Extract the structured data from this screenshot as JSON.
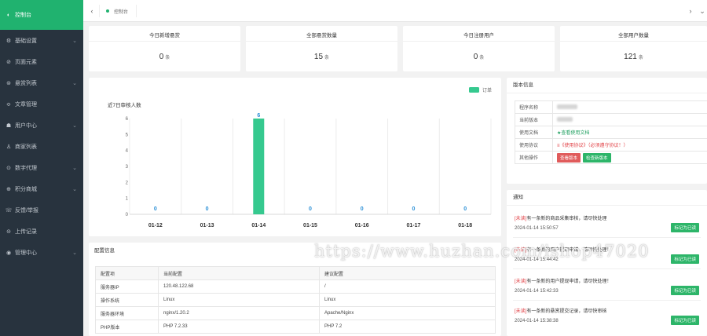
{
  "sidebar": {
    "items": [
      {
        "label": "控制台",
        "icon": "dashboard-icon",
        "glyph": "◐",
        "chevron": false,
        "active": true
      },
      {
        "label": "基础设置",
        "icon": "settings-icon",
        "glyph": "⚙",
        "chevron": true
      },
      {
        "label": "页面元素",
        "icon": "page-icon",
        "glyph": "⊘",
        "chevron": false
      },
      {
        "label": "悬赏列表",
        "icon": "reward-icon",
        "glyph": "⊜",
        "chevron": true
      },
      {
        "label": "文章管理",
        "icon": "article-icon",
        "glyph": "≎",
        "chevron": false
      },
      {
        "label": "用户中心",
        "icon": "user-icon",
        "glyph": "☗",
        "chevron": true
      },
      {
        "label": "商家列表",
        "icon": "shop-icon",
        "glyph": "♙",
        "chevron": false
      },
      {
        "label": "数字代理",
        "icon": "agent-icon",
        "glyph": "⊙",
        "chevron": true
      },
      {
        "label": "积分商城",
        "icon": "mall-icon",
        "glyph": "⊕",
        "chevron": true
      },
      {
        "label": "反馈/举报",
        "icon": "feedback-icon",
        "glyph": "☏",
        "chevron": false
      },
      {
        "label": "上传记录",
        "icon": "upload-icon",
        "glyph": "⊝",
        "chevron": false
      },
      {
        "label": "管理中心",
        "icon": "admin-icon",
        "glyph": "◉",
        "chevron": true
      }
    ]
  },
  "topbar": {
    "prev_glyph": "‹",
    "next_glyph": "›",
    "menu_glyph": "⌄",
    "tab_label": "控制台"
  },
  "stats": [
    {
      "title": "今日新增悬赏",
      "value": "0",
      "unit": "条"
    },
    {
      "title": "全部悬赏数量",
      "value": "15",
      "unit": "条"
    },
    {
      "title": "今日注册用户",
      "value": "0",
      "unit": "条"
    },
    {
      "title": "全部用户数量",
      "value": "121",
      "unit": "条"
    }
  ],
  "chart_data": {
    "type": "bar",
    "title": "近7日审核人数",
    "legend": "订单",
    "legend_position": "top-right",
    "categories": [
      "01-12",
      "01-13",
      "01-14",
      "01-15",
      "01-16",
      "01-17",
      "01-18"
    ],
    "values": [
      0,
      0,
      6,
      0,
      0,
      0,
      0
    ],
    "ylim": [
      0,
      6
    ],
    "yticks": [
      0,
      1,
      2,
      3,
      4,
      5,
      6
    ],
    "grid": true,
    "bar_color": "#36c98f"
  },
  "version_info": {
    "title": "版本信息",
    "rows": [
      {
        "key": "程序名称",
        "value": ""
      },
      {
        "key": "当前版本",
        "value": ""
      },
      {
        "key": "使用文档",
        "value": "★查看使用文档"
      },
      {
        "key": "使用协议",
        "value": "≡《使用协议》（必须遵守协议！）"
      },
      {
        "key": "其他操作",
        "value": ""
      }
    ],
    "buttons": [
      "查看版本",
      "检查新版本"
    ]
  },
  "notices": {
    "title": "通知",
    "button_label": "标记为已读",
    "items": [
      {
        "tag": "[未读]",
        "text": "有一条新的商品采集审核，请尽快处理",
        "time": "2024-01-14 15:50:57"
      },
      {
        "tag": "[未读]",
        "text": "有一条新的用户提现申请，请尽快处理！",
        "time": "2024-01-14 15:44:42"
      },
      {
        "tag": "[未读]",
        "text": "有一条新的用户提现申请，请尽快处理！",
        "time": "2024-01-14 15:42:33"
      },
      {
        "tag": "[未读]",
        "text": "有一条新的悬赏提交记录，请尽快审核",
        "time": "2024-01-14 15:38:38"
      }
    ]
  },
  "config": {
    "title": "配置信息",
    "headers": [
      "配置项",
      "当前配置",
      "建议配置"
    ],
    "rows": [
      [
        "服务器IP",
        "120.48.122.68",
        "/"
      ],
      [
        "操作系统",
        "Linux",
        "Linux"
      ],
      [
        "服务器环境",
        "nginx/1.20.2",
        "Apache/Nginx"
      ],
      [
        "PHP版本",
        "PHP 7.2.33",
        "PHP 7.2"
      ]
    ]
  },
  "watermark": "https://www.huzhan.com/ishop47020"
}
